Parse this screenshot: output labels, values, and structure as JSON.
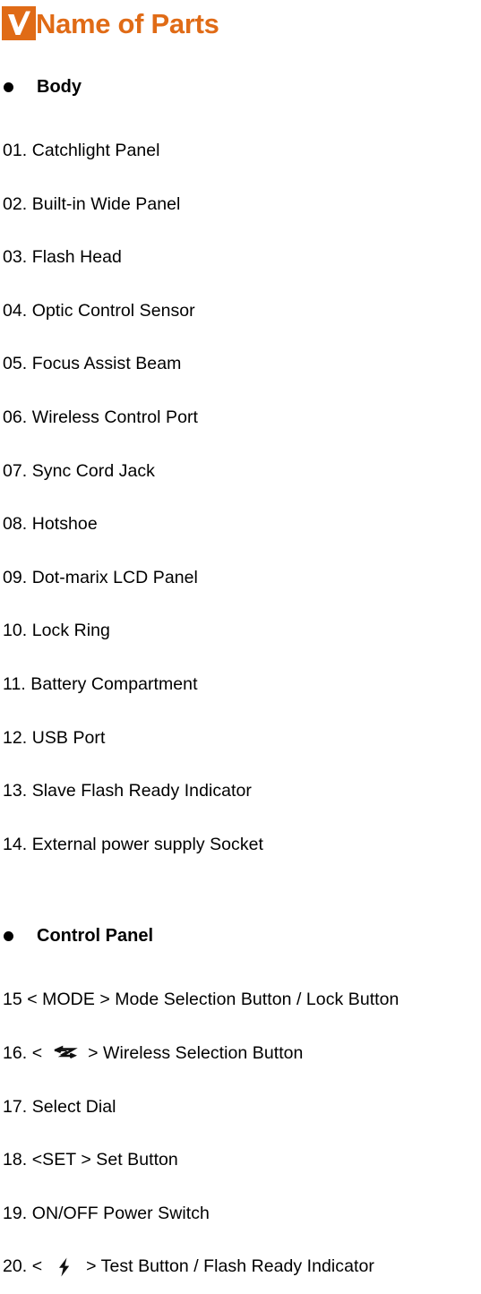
{
  "document": {
    "title": "Name of Parts",
    "title_color": "#E06B16",
    "title_icon": "checkmark-icon"
  },
  "sections": [
    {
      "id": "body",
      "heading": "Body",
      "bullet": "bullet-dot",
      "items": [
        {
          "number": "01.",
          "label": "Catchlight Panel"
        },
        {
          "number": "02.",
          "label": "Built-in Wide Panel"
        },
        {
          "number": "03.",
          "label": "Flash Head"
        },
        {
          "number": "04.",
          "label": "Optic Control Sensor"
        },
        {
          "number": "05.",
          "label": "Focus Assist Beam"
        },
        {
          "number": "06.",
          "label": "Wireless Control Port"
        },
        {
          "number": "07.",
          "label": "Sync Cord Jack"
        },
        {
          "number": "08.",
          "label": "Hotshoe"
        },
        {
          "number": "09.",
          "label": "Dot-marix LCD Panel"
        },
        {
          "number": "10.",
          "label": "Lock Ring"
        },
        {
          "number": "11.",
          "label": "Battery Compartment"
        },
        {
          "number": "12.",
          "label": "USB Port"
        },
        {
          "number": "13.",
          "label": "Slave Flash Ready Indicator"
        },
        {
          "number": "14.",
          "label": "External power supply Socket"
        }
      ]
    },
    {
      "id": "control-panel",
      "heading": "Control Panel",
      "bullet": "bullet-dot",
      "items": [
        {
          "number": "15",
          "label": " < MODE > Mode Selection Button / Lock Button"
        },
        {
          "number": "16.",
          "pre": " < ",
          "icon": "wireless-sync-icon",
          "post": " > Wireless Selection Button"
        },
        {
          "number": "17.",
          "label": " Select Dial"
        },
        {
          "number": "18.",
          "label": " <SET > Set Button"
        },
        {
          "number": "19.",
          "label": " ON/OFF Power Switch"
        },
        {
          "number": "20.",
          "pre": " < ",
          "icon": "flash-bolt-icon",
          "post": " > Test Button / Flash Ready Indicator"
        }
      ]
    }
  ]
}
